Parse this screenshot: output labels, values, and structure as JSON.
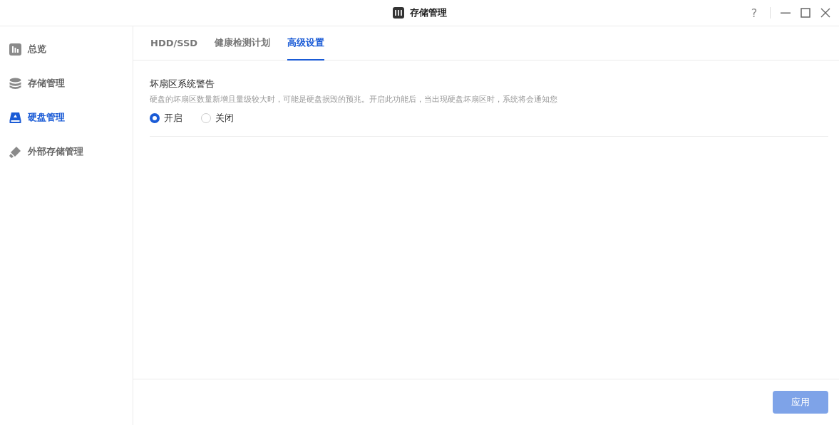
{
  "window": {
    "title": "存储管理",
    "help": "?"
  },
  "sidebar": {
    "items": [
      {
        "kind": "overview",
        "label": "总览",
        "selected": false
      },
      {
        "kind": "storage",
        "label": "存储管理",
        "selected": false
      },
      {
        "kind": "disk",
        "label": "硬盘管理",
        "selected": true
      },
      {
        "kind": "external",
        "label": "外部存储管理",
        "selected": false
      }
    ]
  },
  "tabs": [
    {
      "label": "HDD/SSD",
      "selected": false
    },
    {
      "label": "健康检测计划",
      "selected": false
    },
    {
      "label": "高级设置",
      "selected": true
    }
  ],
  "section": {
    "title": "坏扇区系统警告",
    "description": "硬盘的坏扇区数量新增且量级较大时，可能是硬盘损毁的预兆。开启此功能后，当出现硬盘坏扇区时，系统将会通知您",
    "options": [
      {
        "label": "开启",
        "selected": true
      },
      {
        "label": "关闭",
        "selected": false
      }
    ]
  },
  "apply_button": {
    "label": "应用",
    "disabled": true
  }
}
